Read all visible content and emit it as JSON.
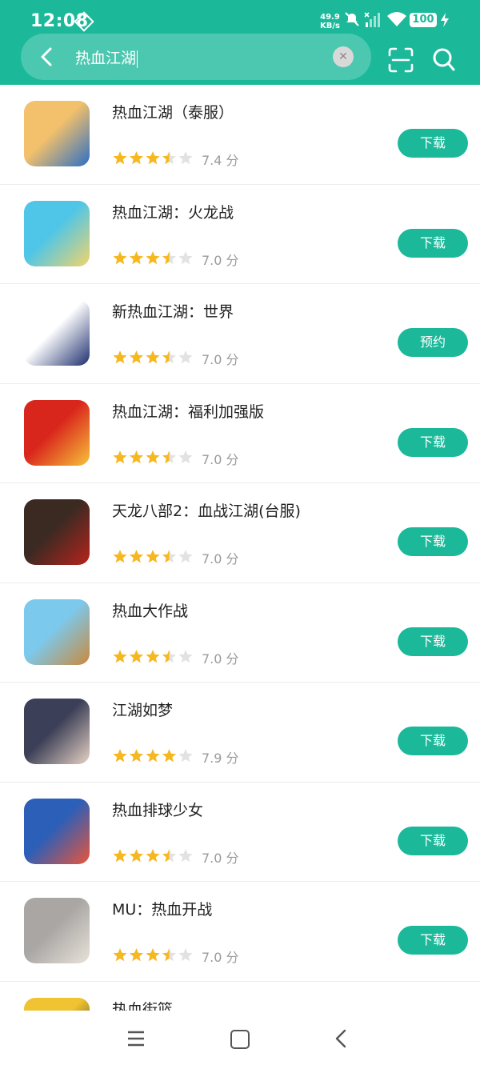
{
  "status": {
    "time": "12:08",
    "net_speed_value": "49.9",
    "net_speed_unit": "KB/s",
    "battery": "100"
  },
  "search": {
    "query": "热血江湖"
  },
  "apps": [
    {
      "name": "热血江湖（泰服）",
      "score": "7.4 分",
      "stars": 3.5,
      "action": "下载",
      "icon_colors": [
        "#f3c16b",
        "#2b6fc4"
      ]
    },
    {
      "name": "热血江湖：火龙战",
      "score": "7.0 分",
      "stars": 3.5,
      "action": "下载",
      "icon_colors": [
        "#4fc6e8",
        "#f2d46a"
      ]
    },
    {
      "name": "新热血江湖：世界",
      "score": "7.0 分",
      "stars": 3.5,
      "action": "预约",
      "icon_colors": [
        "#ffffff",
        "#1e2f6e"
      ]
    },
    {
      "name": "热血江湖：福利加强版",
      "score": "7.0 分",
      "stars": 3.5,
      "action": "下载",
      "icon_colors": [
        "#d9261c",
        "#f7c23a"
      ]
    },
    {
      "name": "天龙八部2：血战江湖(台服)",
      "score": "7.0 分",
      "stars": 3.5,
      "action": "下载",
      "icon_colors": [
        "#3a2a22",
        "#b8241d"
      ]
    },
    {
      "name": "热血大作战",
      "score": "7.0 分",
      "stars": 3.5,
      "action": "下载",
      "icon_colors": [
        "#7cc9ee",
        "#c9893c"
      ]
    },
    {
      "name": "江湖如梦",
      "score": "7.9 分",
      "stars": 4,
      "action": "下载",
      "icon_colors": [
        "#3b3f57",
        "#e7d2c4"
      ]
    },
    {
      "name": "热血排球少女",
      "score": "7.0 分",
      "stars": 3.5,
      "action": "下载",
      "icon_colors": [
        "#2b5fb8",
        "#e9553b"
      ]
    },
    {
      "name": "MU：热血开战",
      "score": "7.0 分",
      "stars": 3.5,
      "action": "下载",
      "icon_colors": [
        "#a9a6a4",
        "#e8e2d8"
      ]
    },
    {
      "name": "热血街篮",
      "score": "",
      "stars": 0,
      "action": "",
      "icon_colors": [
        "#f0c332",
        "#222222"
      ]
    }
  ],
  "colors": {
    "accent": "#1bb99a",
    "star": "#f6b821",
    "star_empty": "#e2e2e2"
  }
}
